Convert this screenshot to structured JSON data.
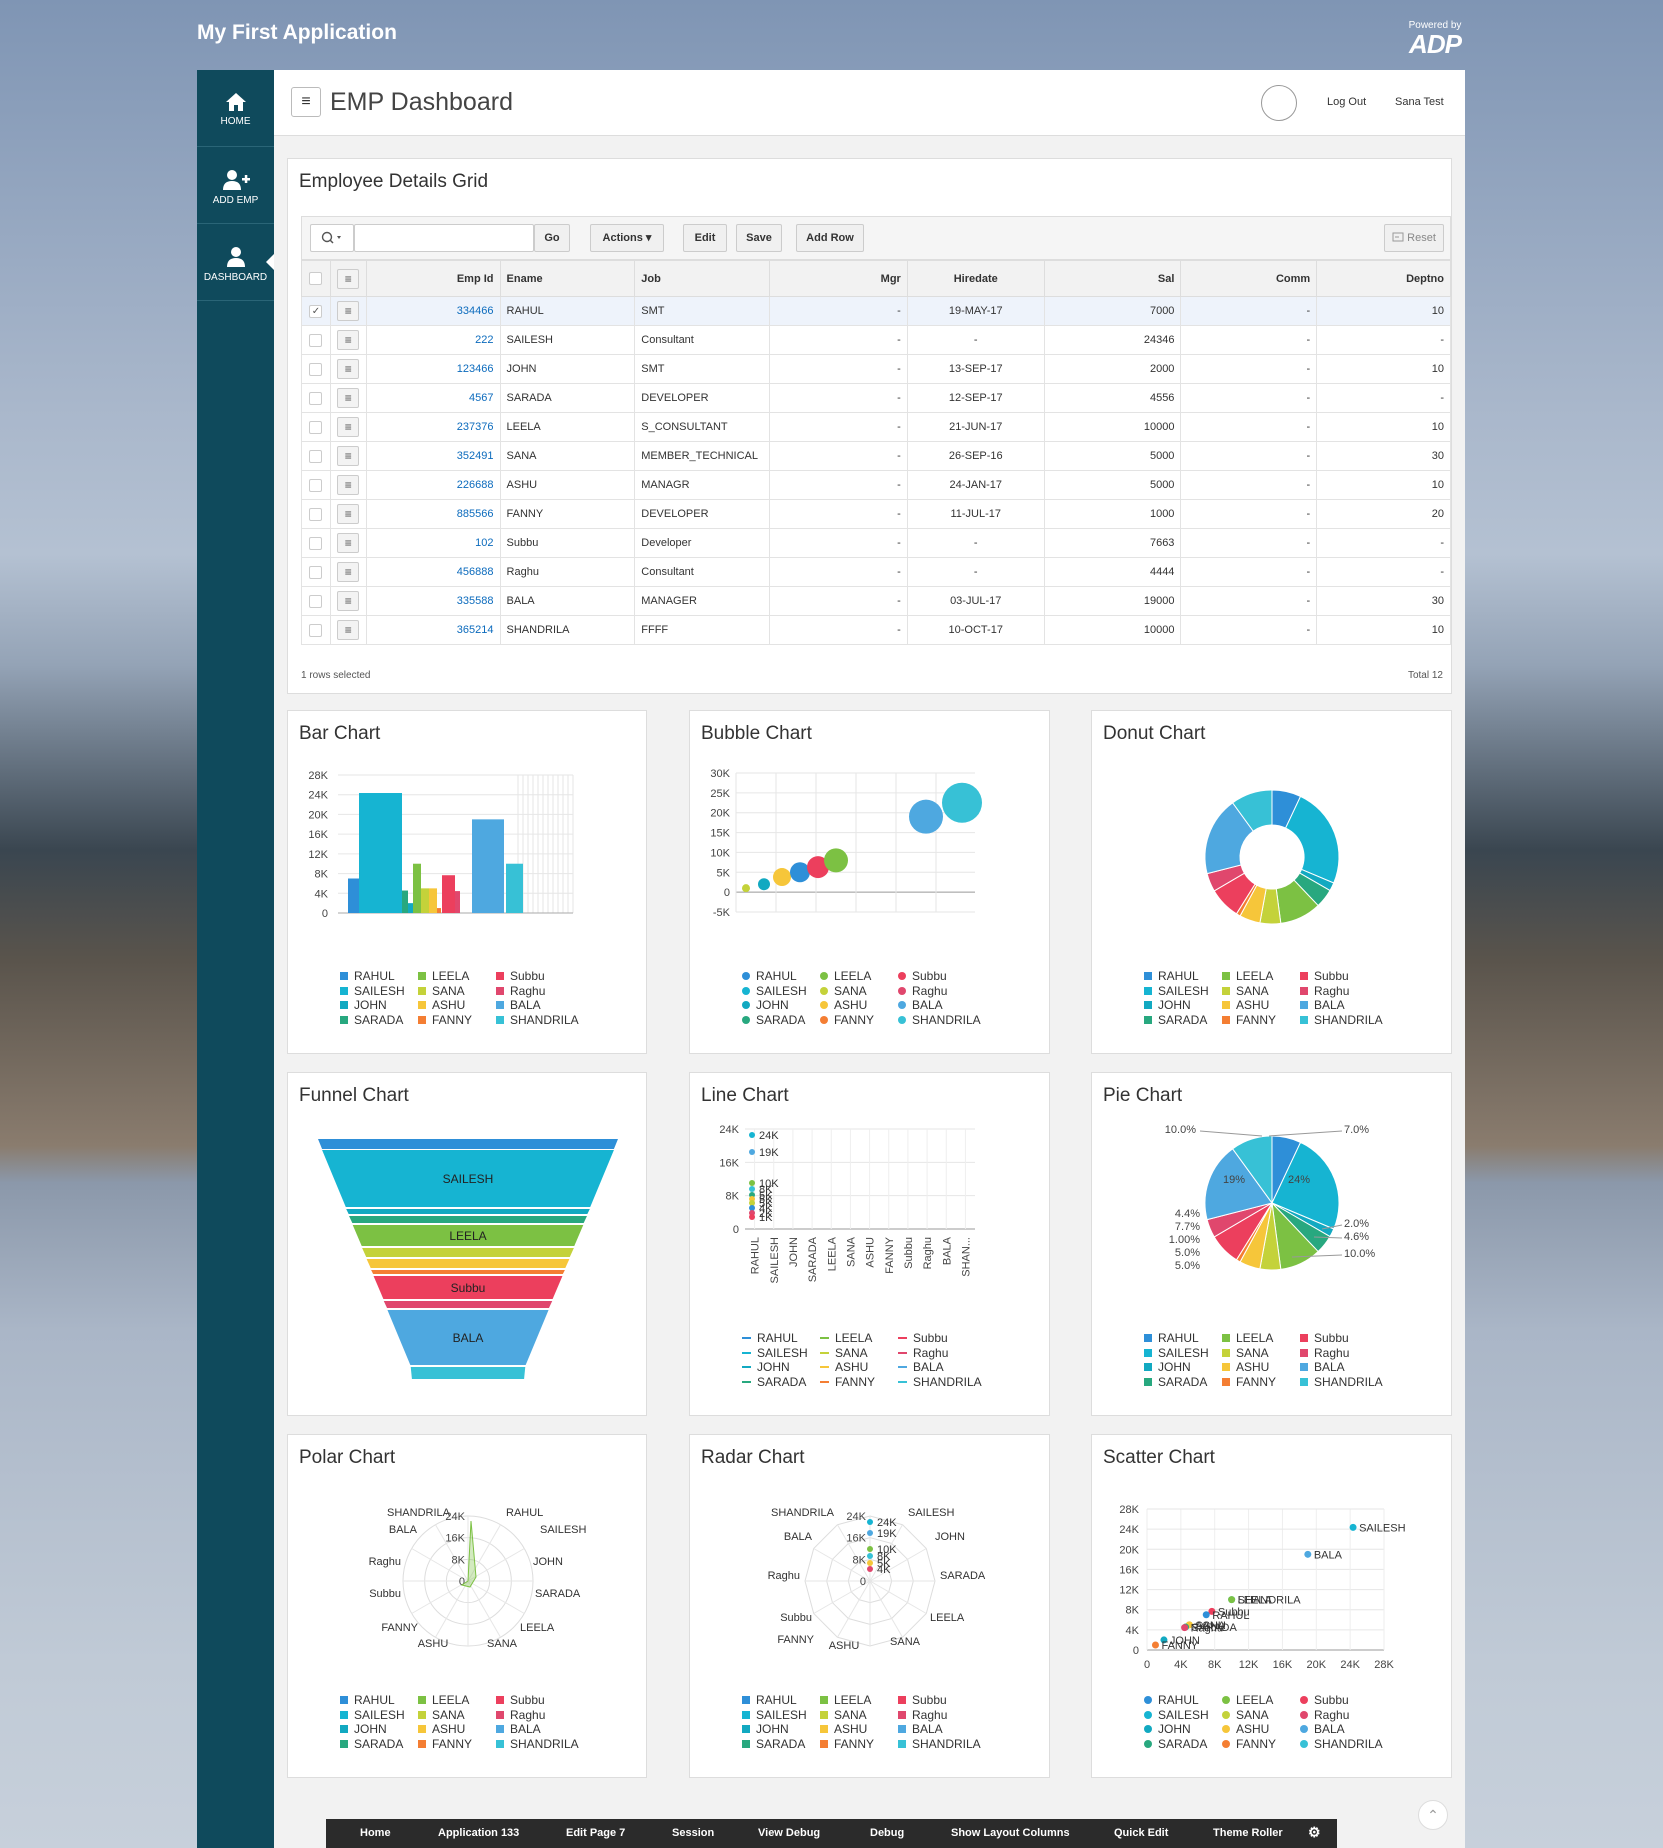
{
  "app": {
    "title": "My First Application",
    "powered_by": "Powered by",
    "brand": "ADP"
  },
  "nav": [
    {
      "label": "HOME",
      "icon": "home-icon"
    },
    {
      "label": "ADD EMP",
      "icon": "add-user-icon"
    },
    {
      "label": "DASHBOARD",
      "icon": "user-icon"
    }
  ],
  "topbar": {
    "title": "EMP Dashboard",
    "logout": "Log Out",
    "username": "Sana Test",
    "menu_icon": "≡"
  },
  "grid": {
    "title": "Employee Details Grid",
    "toolbar": {
      "go": "Go",
      "actions": "Actions ▾",
      "edit": "Edit",
      "save": "Save",
      "add_row": "Add Row",
      "reset": "Reset",
      "search_value": ""
    },
    "columns": [
      "Emp Id",
      "Ename",
      "Job",
      "Mgr",
      "Hiredate",
      "Sal",
      "Comm",
      "Deptno"
    ],
    "rows": [
      {
        "empid": "334466",
        "ename": "RAHUL",
        "job": "SMT",
        "mgr": "-",
        "hiredate": "19-MAY-17",
        "sal": "7000",
        "comm": "-",
        "deptno": "10",
        "selected": true
      },
      {
        "empid": "222",
        "ename": "SAILESH",
        "job": "Consultant",
        "mgr": "-",
        "hiredate": "-",
        "sal": "24346",
        "comm": "-",
        "deptno": "-"
      },
      {
        "empid": "123466",
        "ename": "JOHN",
        "job": "SMT",
        "mgr": "-",
        "hiredate": "13-SEP-17",
        "sal": "2000",
        "comm": "-",
        "deptno": "10"
      },
      {
        "empid": "4567",
        "ename": "SARADA",
        "job": "DEVELOPER",
        "mgr": "-",
        "hiredate": "12-SEP-17",
        "sal": "4556",
        "comm": "-",
        "deptno": "-"
      },
      {
        "empid": "237376",
        "ename": "LEELA",
        "job": "S_CONSULTANT",
        "mgr": "-",
        "hiredate": "21-JUN-17",
        "sal": "10000",
        "comm": "-",
        "deptno": "10"
      },
      {
        "empid": "352491",
        "ename": "SANA",
        "job": "MEMBER_TECHNICAL",
        "mgr": "-",
        "hiredate": "26-SEP-16",
        "sal": "5000",
        "comm": "-",
        "deptno": "30"
      },
      {
        "empid": "226688",
        "ename": "ASHU",
        "job": "MANAGR",
        "mgr": "-",
        "hiredate": "24-JAN-17",
        "sal": "5000",
        "comm": "-",
        "deptno": "10"
      },
      {
        "empid": "885566",
        "ename": "FANNY",
        "job": "DEVELOPER",
        "mgr": "-",
        "hiredate": "11-JUL-17",
        "sal": "1000",
        "comm": "-",
        "deptno": "20"
      },
      {
        "empid": "102",
        "ename": "Subbu",
        "job": "Developer",
        "mgr": "-",
        "hiredate": "-",
        "sal": "7663",
        "comm": "-",
        "deptno": "-"
      },
      {
        "empid": "456888",
        "ename": "Raghu",
        "job": "Consultant",
        "mgr": "-",
        "hiredate": "-",
        "sal": "4444",
        "comm": "-",
        "deptno": "-"
      },
      {
        "empid": "335588",
        "ename": "BALA",
        "job": "MANAGER",
        "mgr": "-",
        "hiredate": "03-JUL-17",
        "sal": "19000",
        "comm": "-",
        "deptno": "30"
      },
      {
        "empid": "365214",
        "ename": "SHANDRILA",
        "job": "FFFF",
        "mgr": "-",
        "hiredate": "10-OCT-17",
        "sal": "10000",
        "comm": "-",
        "deptno": "10"
      }
    ],
    "footer_selected": "1 rows selected",
    "footer_total": "Total 12"
  },
  "charts": {
    "titles": {
      "bar": "Bar Chart",
      "bubble": "Bubble Chart",
      "donut": "Donut Chart",
      "funnel": "Funnel Chart",
      "line": "Line Chart",
      "pie": "Pie Chart",
      "polar": "Polar Chart",
      "radar": "Radar Chart",
      "scatter": "Scatter Chart"
    },
    "legend": [
      "RAHUL",
      "SAILESH",
      "JOHN",
      "SARADA",
      "LEELA",
      "SANA",
      "ASHU",
      "FANNY",
      "Subbu",
      "Raghu",
      "BALA",
      "SHANDRILA"
    ],
    "colors": [
      "#2e8fd8",
      "#16b4d2",
      "#12a9c1",
      "#28a87f",
      "#7cc143",
      "#c4d23a",
      "#f6c63a",
      "#f47e33",
      "#ec3f5d",
      "#e0476d",
      "#4ea8e0",
      "#37c1d6"
    ]
  },
  "chart_data": [
    {
      "type": "bar",
      "title": "Bar Chart",
      "categories": [
        "RAHUL",
        "SAILESH",
        "JOHN",
        "SARADA",
        "LEELA",
        "SANA",
        "ASHU",
        "FANNY",
        "Subbu",
        "Raghu",
        "BALA",
        "SHANDRILA"
      ],
      "values": [
        7000,
        24346,
        2000,
        4556,
        10000,
        5000,
        5000,
        1000,
        7663,
        4444,
        19000,
        10000
      ],
      "ylim": [
        0,
        28000
      ],
      "yticks": [
        "0",
        "4K",
        "8K",
        "12K",
        "16K",
        "20K",
        "24K",
        "28K"
      ]
    },
    {
      "type": "scatter",
      "title": "Bubble Chart",
      "series": [
        {
          "name": "SANA",
          "x": 1,
          "y": 1000
        },
        {
          "name": "JOHN",
          "x": 2,
          "y": 2000
        },
        {
          "name": "ASHU",
          "x": 3,
          "y": 3800
        },
        {
          "name": "RAHUL",
          "x": 4,
          "y": 5000
        },
        {
          "name": "Subbu",
          "x": 5,
          "y": 6300
        },
        {
          "name": "LEELA",
          "x": 6,
          "y": 8000
        },
        {
          "name": "BALA",
          "x": 11,
          "y": 19000
        },
        {
          "name": "SHANDRILA",
          "x": 13,
          "y": 22500
        }
      ],
      "ylim": [
        -5000,
        30000
      ],
      "yticks": [
        "-5K",
        "0",
        "5K",
        "10K",
        "15K",
        "20K",
        "25K",
        "30K"
      ]
    },
    {
      "type": "pie",
      "title": "Donut Chart",
      "categories": [
        "RAHUL",
        "SAILESH",
        "JOHN",
        "SARADA",
        "LEELA",
        "SANA",
        "ASHU",
        "FANNY",
        "Subbu",
        "Raghu",
        "BALA",
        "SHANDRILA"
      ],
      "values": [
        7000,
        24346,
        2000,
        4556,
        10000,
        5000,
        5000,
        1000,
        7663,
        4444,
        19000,
        10000
      ]
    },
    {
      "type": "bar",
      "title": "Funnel Chart",
      "categories": [
        "SAILESH",
        "BALA",
        "LEELA",
        "SHANDRILA",
        "Subbu",
        "RAHUL",
        "ASHU",
        "SANA",
        "SARADA",
        "Raghu",
        "JOHN",
        "FANNY"
      ],
      "values": [
        24346,
        19000,
        10000,
        10000,
        7663,
        7000,
        5000,
        5000,
        4556,
        4444,
        2000,
        1000
      ]
    },
    {
      "type": "line",
      "title": "Line Chart",
      "categories": [
        "RAHUL",
        "SAILESH",
        "JOHN",
        "SARADA",
        "LEELA",
        "SANA",
        "ASHU",
        "FANNY",
        "Subbu",
        "Raghu",
        "BALA",
        "SHAN..."
      ],
      "value_labels": [
        "24K",
        "19K",
        "10K",
        "8K",
        "5K",
        "5K",
        "5K",
        "4K",
        "2K",
        "1K"
      ],
      "ylim": [
        0,
        24000
      ],
      "yticks": [
        "0",
        "8K",
        "16K",
        "24K"
      ]
    },
    {
      "type": "pie",
      "title": "Pie Chart",
      "categories": [
        "RAHUL",
        "SAILESH",
        "JOHN",
        "SARADA",
        "LEELA",
        "SANA",
        "ASHU",
        "FANNY",
        "Subbu",
        "Raghu",
        "BALA",
        "SHANDRILA"
      ],
      "values": [
        7000,
        24346,
        2000,
        4556,
        10000,
        5000,
        5000,
        1000,
        7663,
        4444,
        19000,
        10000
      ],
      "labels": [
        "7.0%",
        "24%",
        "2.0%",
        "4.6%",
        "10.0%",
        "5.0%",
        "5.0%",
        "1.00%",
        "7.7%",
        "4.4%",
        "19%",
        "10.0%"
      ]
    },
    {
      "type": "line",
      "title": "Polar Chart",
      "categories": [
        "RAHUL",
        "SAILESH",
        "JOHN",
        "SARADA",
        "LEELA",
        "SANA",
        "ASHU",
        "FANNY",
        "Subbu",
        "Raghu",
        "BALA",
        "SHANDRILA"
      ],
      "yticks": [
        "0",
        "8K",
        "16K",
        "24K"
      ]
    },
    {
      "type": "line",
      "title": "Radar Chart",
      "categories": [
        "SAILESH",
        "JOHN",
        "SARADA",
        "LEELA",
        "SANA",
        "ASHU",
        "FANNY",
        "Subbu",
        "Raghu",
        "BALA",
        "SHANDRILA"
      ],
      "yticks": [
        "0",
        "8K",
        "16K",
        "24K"
      ],
      "value_labels": [
        "24K",
        "19K",
        "10K",
        "8K",
        "5K",
        "4K"
      ]
    },
    {
      "type": "scatter",
      "title": "Scatter Chart",
      "series": [
        {
          "name": "SAILESH",
          "x": 24346,
          "y": 24346
        },
        {
          "name": "BALA",
          "x": 19000,
          "y": 19000
        },
        {
          "name": "SHANDRILA",
          "x": 10000,
          "y": 10000
        },
        {
          "name": "LEELA",
          "x": 10000,
          "y": 10000
        },
        {
          "name": "Subbu",
          "x": 7663,
          "y": 7663
        },
        {
          "name": "RAHUL",
          "x": 7000,
          "y": 7000
        },
        {
          "name": "SANA",
          "x": 5000,
          "y": 5000
        },
        {
          "name": "ASHU",
          "x": 5000,
          "y": 5000
        },
        {
          "name": "SARADA",
          "x": 4556,
          "y": 4556
        },
        {
          "name": "Raghu",
          "x": 4444,
          "y": 4444
        },
        {
          "name": "JOHN",
          "x": 2000,
          "y": 2000
        },
        {
          "name": "FANNY",
          "x": 1000,
          "y": 1000
        }
      ],
      "xlim": [
        0,
        28000
      ],
      "ylim": [
        0,
        28000
      ],
      "ticks": [
        "0",
        "4K",
        "8K",
        "12K",
        "16K",
        "20K",
        "24K",
        "28K"
      ]
    }
  ],
  "devbar": [
    "Home",
    "Application 133",
    "Edit Page 7",
    "Session",
    "View Debug",
    "Debug",
    "Show Layout Columns",
    "Quick Edit",
    "Theme Roller"
  ]
}
